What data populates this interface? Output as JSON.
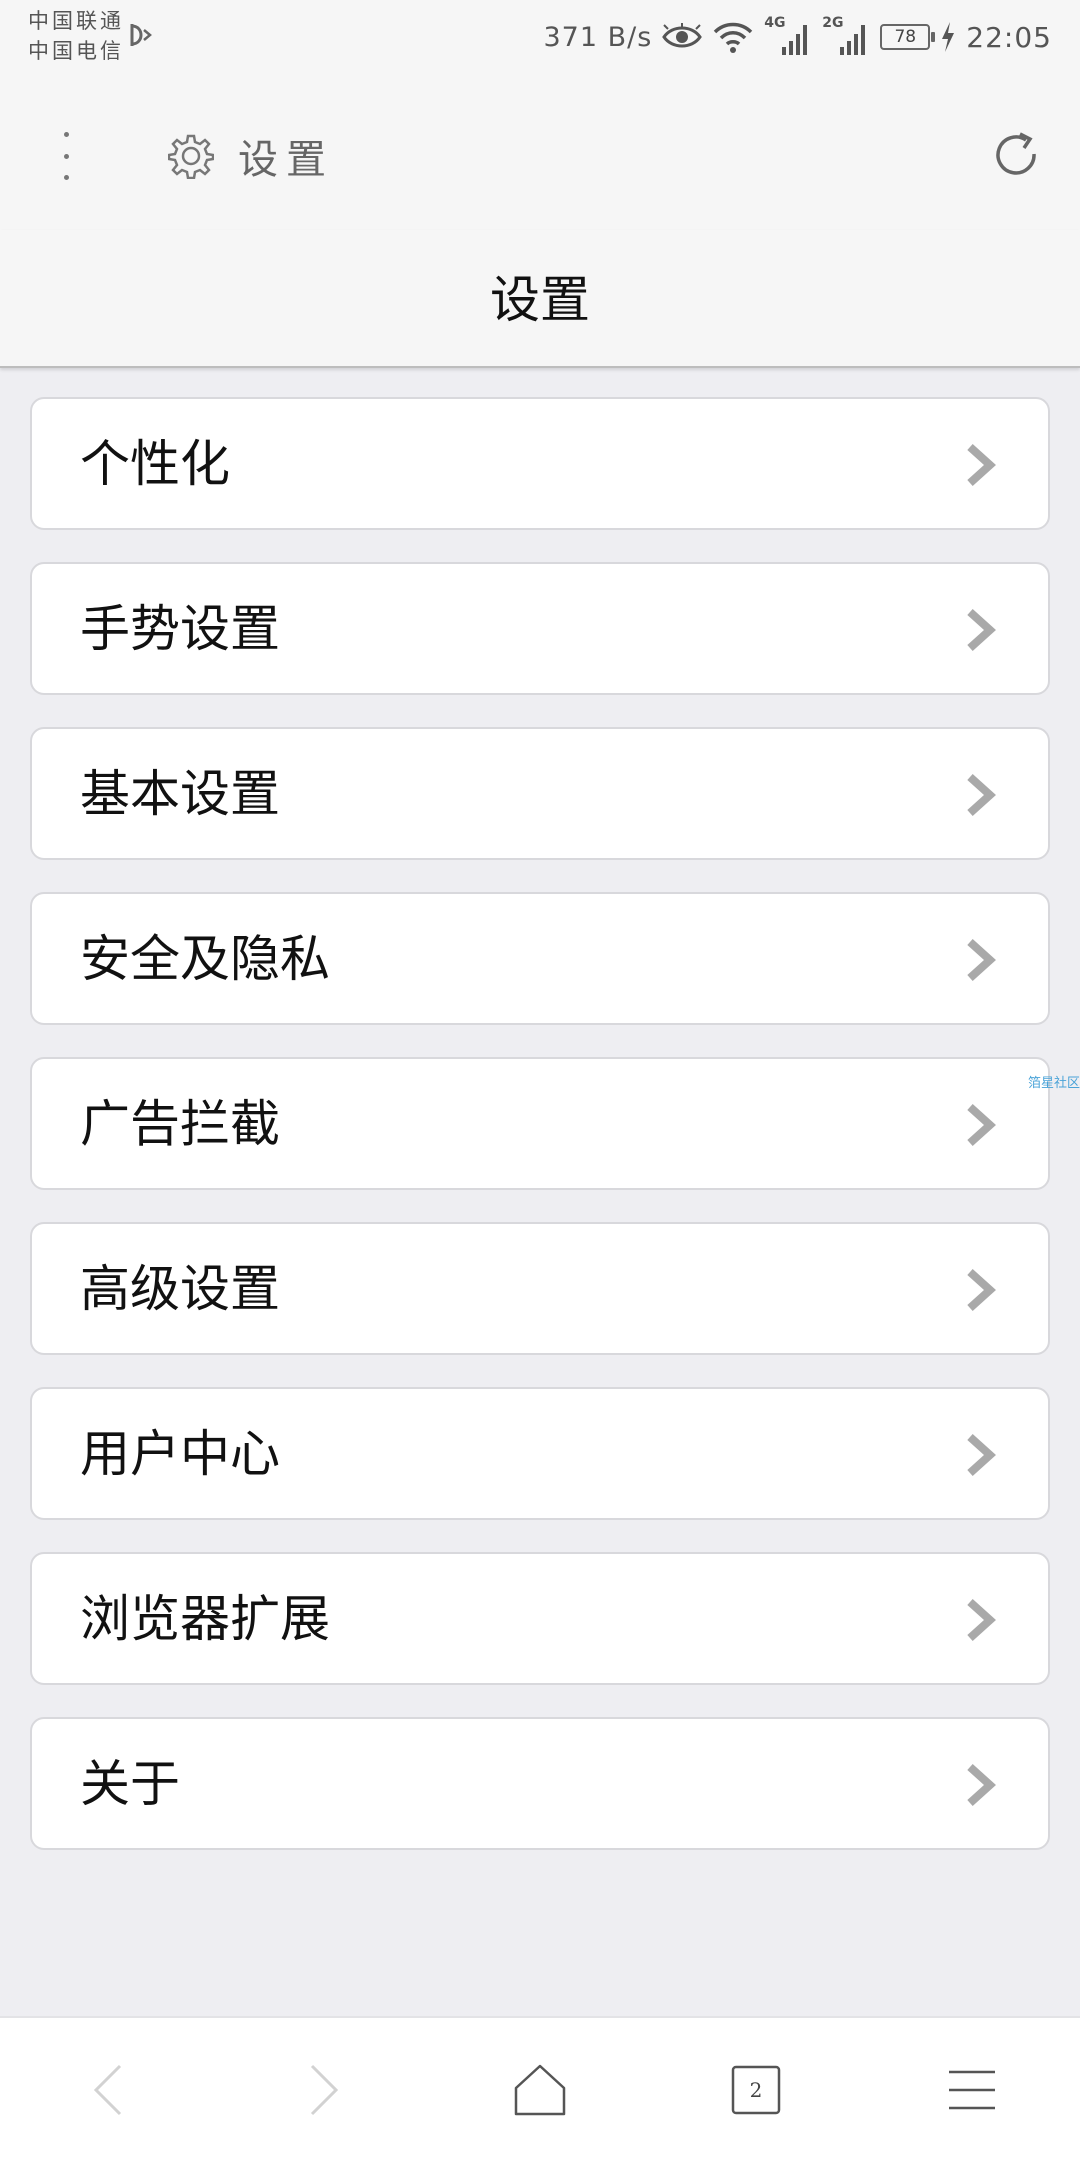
{
  "status_bar": {
    "carrier_1": "中国联通",
    "carrier_2": "中国电信",
    "net_speed": "371 B/s",
    "signal_1_label": "4G",
    "signal_2_label": "2G",
    "battery": "78",
    "time": "22:05"
  },
  "toolbar": {
    "address_title": "设置"
  },
  "page": {
    "title": "设置"
  },
  "menu": {
    "items": [
      {
        "label": "个性化"
      },
      {
        "label": "手势设置"
      },
      {
        "label": "基本设置"
      },
      {
        "label": "安全及隐私"
      },
      {
        "label": "广告拦截"
      },
      {
        "label": "高级设置"
      },
      {
        "label": "用户中心"
      },
      {
        "label": "浏览器扩展"
      },
      {
        "label": "关于"
      }
    ]
  },
  "watermark": "箔星社区",
  "bottom_nav": {
    "tabs_count": "2"
  }
}
